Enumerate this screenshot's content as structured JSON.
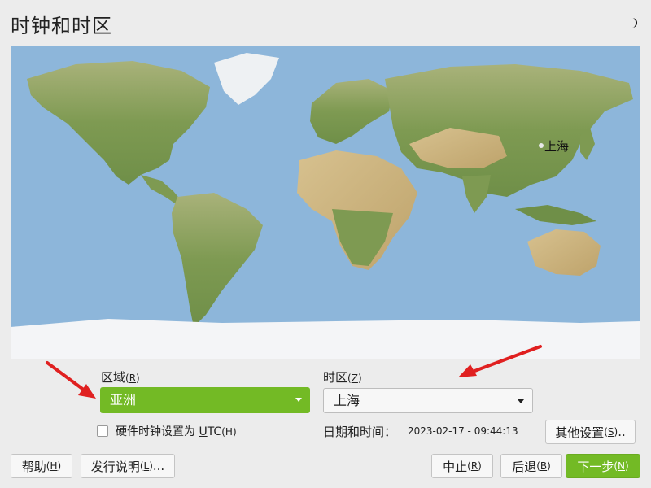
{
  "window": {
    "title": "时钟和时区",
    "theme_icon": "moon-icon"
  },
  "map": {
    "selected_city": "上海",
    "water_color": "#8db6da",
    "land_color": "#7e9a52"
  },
  "region": {
    "label": "区域",
    "mnemonic": "R",
    "value": "亚洲"
  },
  "timezone": {
    "label": "时区",
    "mnemonic": "Z",
    "value": "上海"
  },
  "utc": {
    "label_prefix": "硬件时钟设置为 ",
    "mnemonic": "U",
    "label_rest": "TC",
    "mnemonic_key": "H",
    "checked": false
  },
  "datetime": {
    "label": "日期和时间：",
    "value": "2023-02-17 - 09:44:13"
  },
  "buttons": {
    "other_settings": {
      "label": "其他设置",
      "mnemonic": "S",
      "suffix": ".."
    },
    "help": {
      "label": "帮助",
      "mnemonic": "H"
    },
    "release_notes": {
      "label": "发行说明",
      "mnemonic": "L",
      "suffix": "..."
    },
    "abort": {
      "label": "中止",
      "mnemonic": "R"
    },
    "back": {
      "label": "后退",
      "mnemonic": "B"
    },
    "next": {
      "label": "下一步",
      "mnemonic": "N"
    }
  },
  "colors": {
    "accent": "#73ba25",
    "annotation_arrow": "#e02020"
  }
}
